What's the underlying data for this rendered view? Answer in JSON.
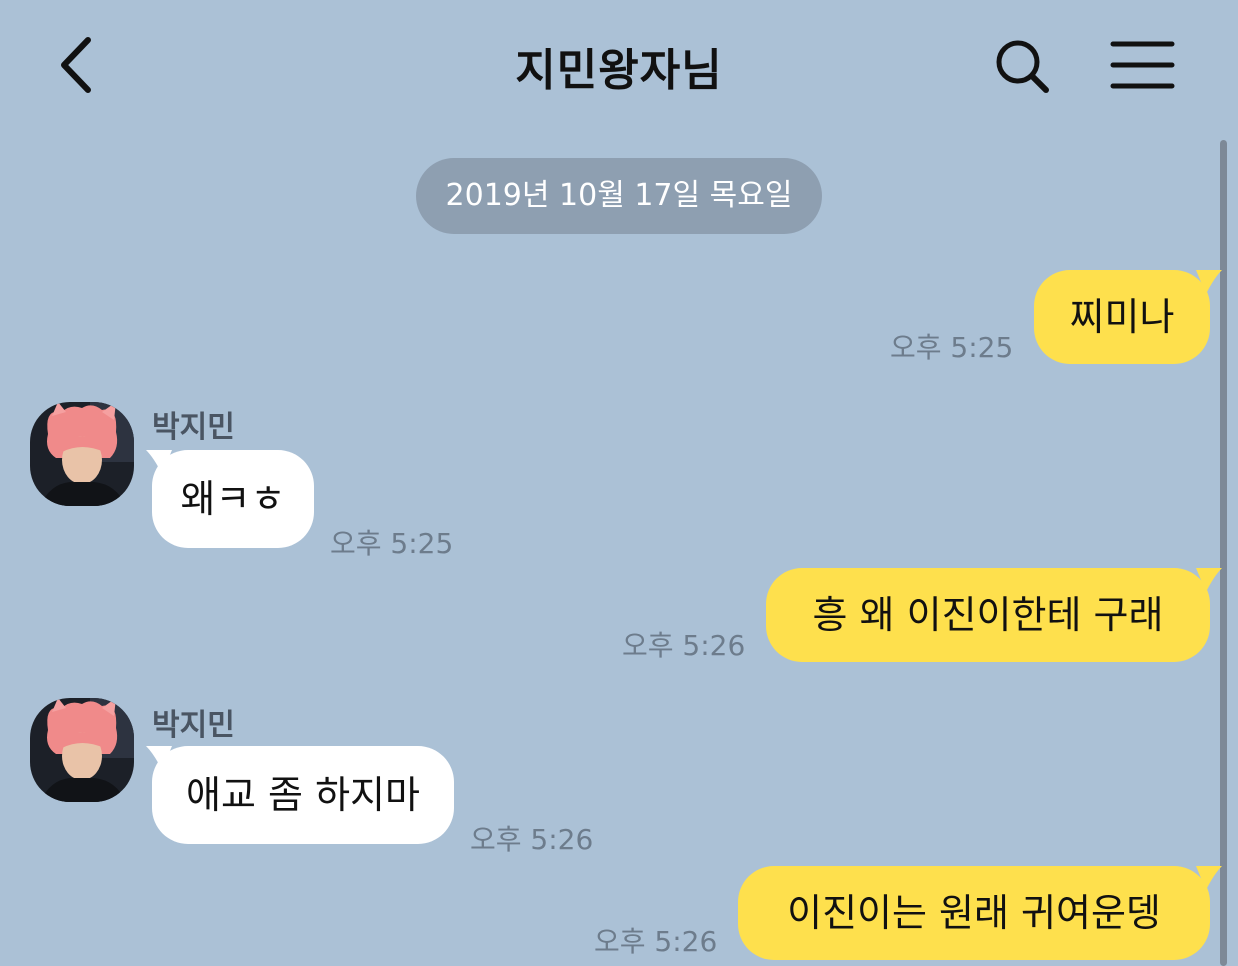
{
  "header": {
    "title": "지민왕자님",
    "back_icon": "chevron-left-icon",
    "search_icon": "search-icon",
    "menu_icon": "hamburger-menu-icon"
  },
  "date_divider": "2019년 10월 17일 목요일",
  "colors": {
    "background": "#abc1d6",
    "my_bubble": "#fee04d",
    "their_bubble": "#ffffff",
    "date_pill": "#8e9fb1"
  },
  "messages": [
    {
      "side": "mine",
      "text": "찌미나",
      "time": "오후 5:25"
    },
    {
      "side": "theirs",
      "sender": "박지민",
      "text": "왜ㅋㅎ",
      "time": "오후 5:25"
    },
    {
      "side": "mine",
      "text": "흥 왜 이진이한테 구래",
      "time": "오후 5:26"
    },
    {
      "side": "theirs",
      "sender": "박지민",
      "text": "애교 좀 하지마",
      "time": "오후 5:26"
    },
    {
      "side": "mine",
      "text": "이진이는 원래 귀여운뎅",
      "time": "오후 5:26"
    }
  ]
}
